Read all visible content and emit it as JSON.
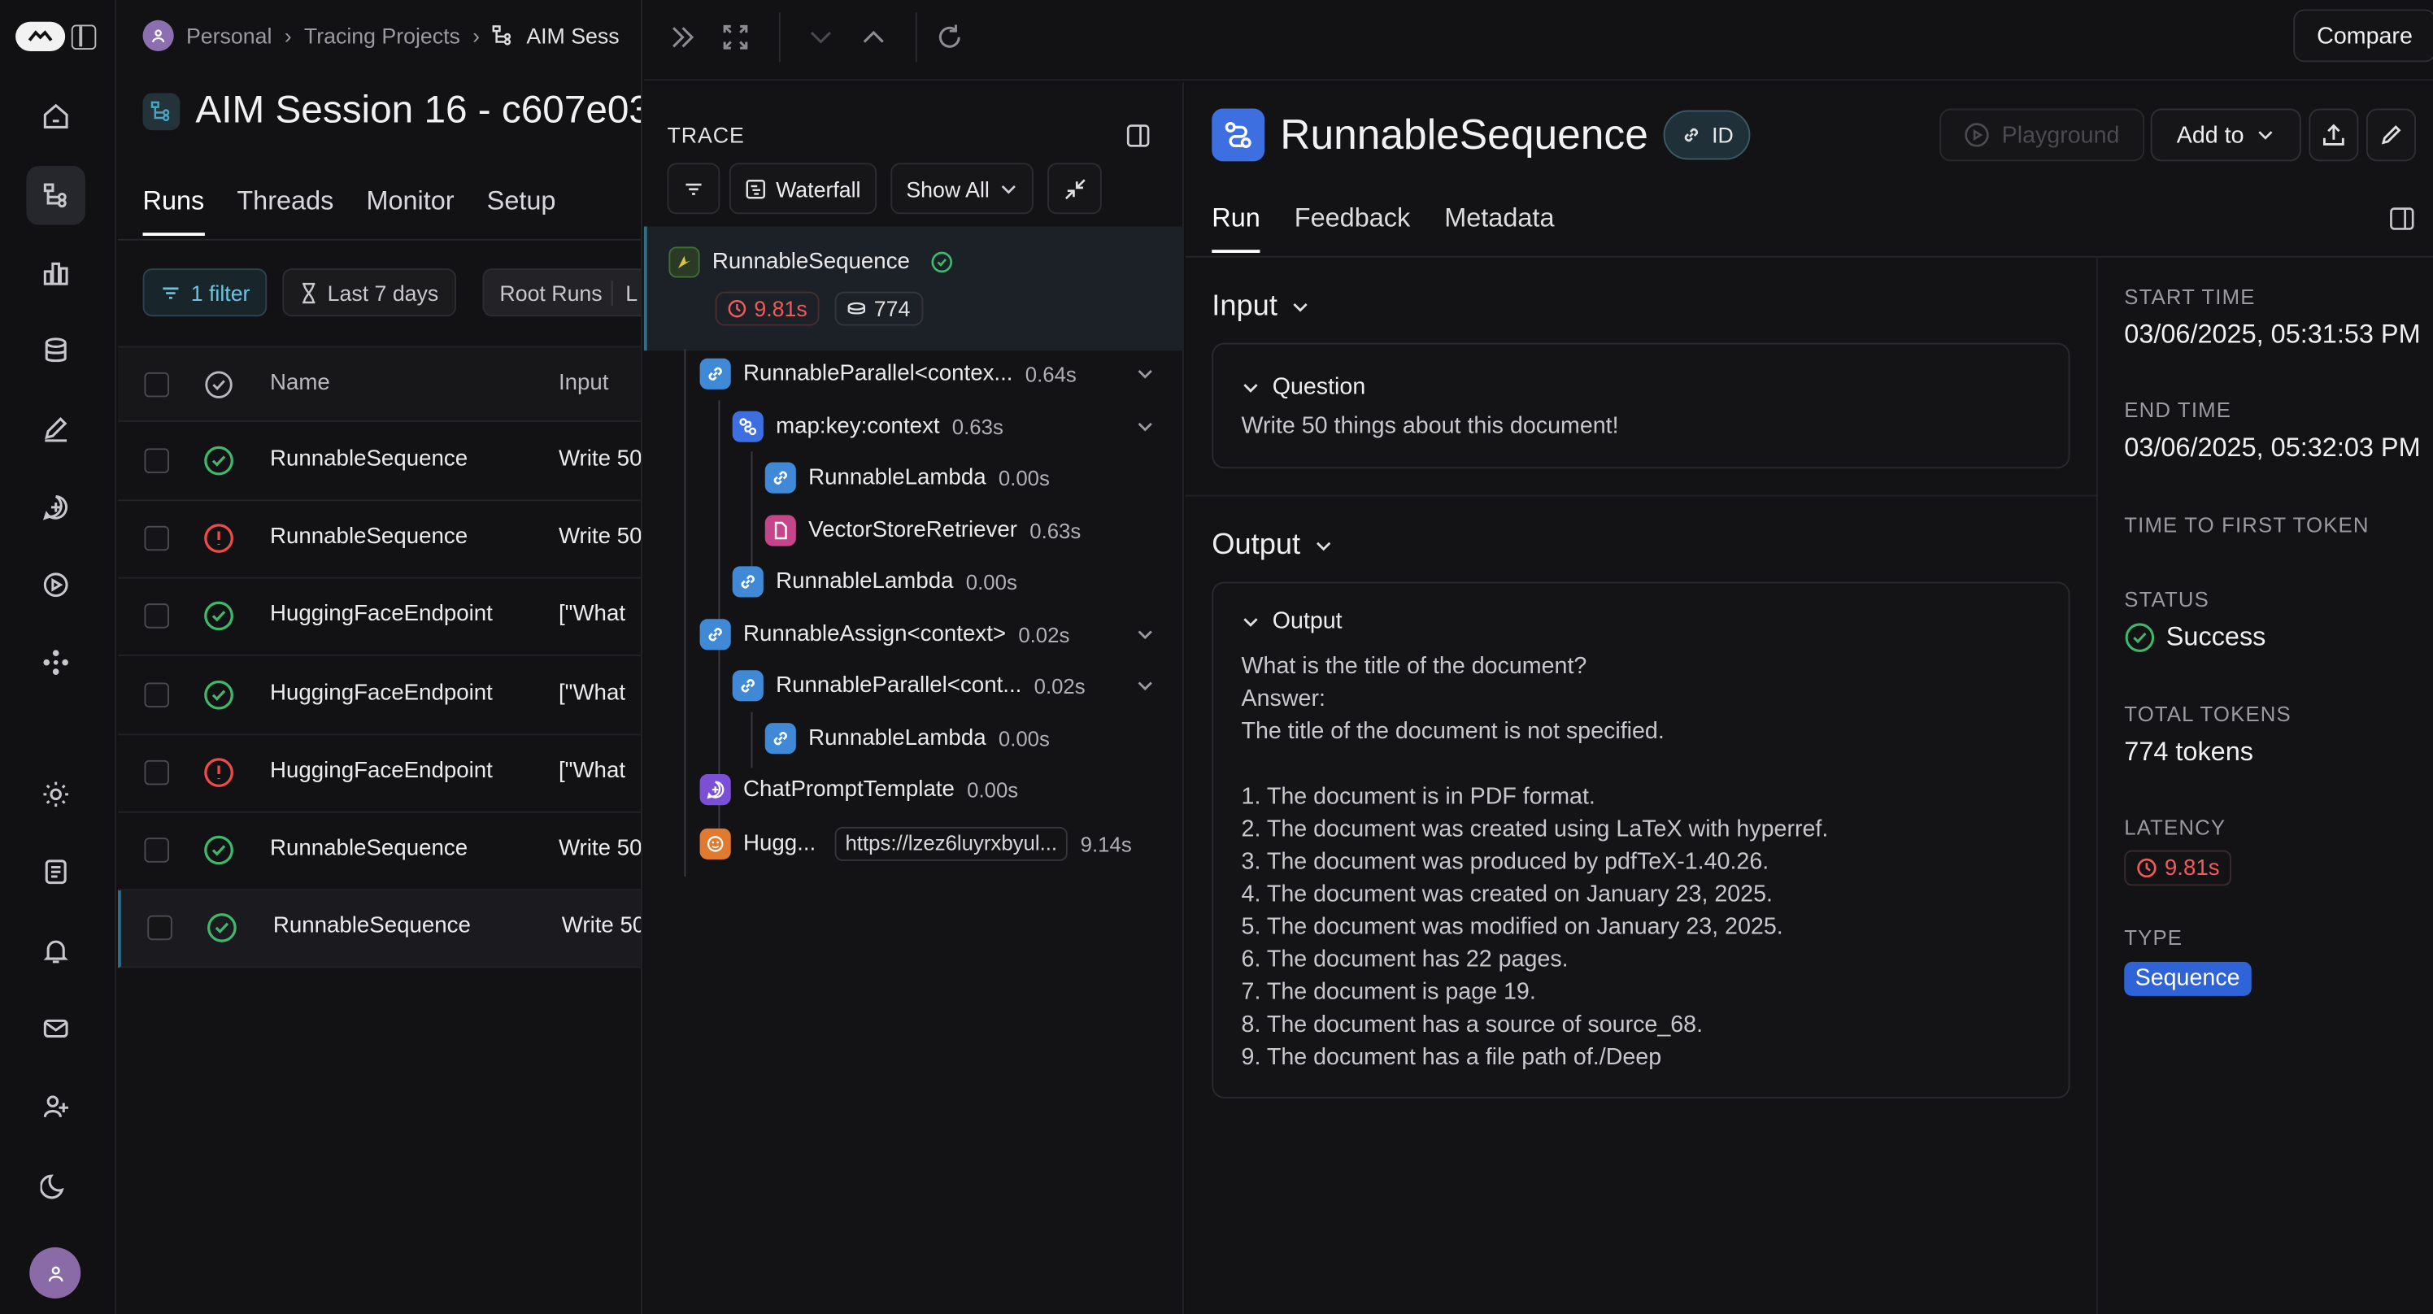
{
  "breadcrumb": {
    "items": [
      "Personal",
      "Tracing Projects",
      "AIM Sess"
    ]
  },
  "project": {
    "title": "AIM Session 16 - c607e03"
  },
  "runs_tabs": [
    "Runs",
    "Threads",
    "Monitor",
    "Setup"
  ],
  "filters": {
    "filter": "1 filter",
    "time": "Last 7 days",
    "root": "Root Runs",
    "extra": "L"
  },
  "table": {
    "headers": {
      "name": "Name",
      "input": "Input"
    },
    "rows": [
      {
        "status": "success",
        "name": "RunnableSequence",
        "input": "Write 50"
      },
      {
        "status": "error",
        "name": "RunnableSequence",
        "input": "Write 50"
      },
      {
        "status": "success",
        "name": "HuggingFaceEndpoint",
        "input": "[\"What"
      },
      {
        "status": "success",
        "name": "HuggingFaceEndpoint",
        "input": "[\"What"
      },
      {
        "status": "error",
        "name": "HuggingFaceEndpoint",
        "input": "[\"What"
      },
      {
        "status": "success",
        "name": "RunnableSequence",
        "input": "Write 50"
      },
      {
        "status": "success",
        "name": "RunnableSequence",
        "input": "Write 50"
      }
    ]
  },
  "topbar": {
    "compare": "Compare"
  },
  "trace": {
    "label": "TRACE",
    "waterfall": "Waterfall",
    "show_all": "Show All",
    "root": {
      "name": "RunnableSequence",
      "latency": "9.81s",
      "tokens": "774"
    },
    "nodes": [
      {
        "name": "RunnableParallel<contex...",
        "dur": "0.64s"
      },
      {
        "name": "map:key:context",
        "dur": "0.63s"
      },
      {
        "name": "RunnableLambda",
        "dur": "0.00s"
      },
      {
        "name": "VectorStoreRetriever",
        "dur": "0.63s"
      },
      {
        "name": "RunnableLambda",
        "dur": "0.00s"
      },
      {
        "name": "RunnableAssign<context>",
        "dur": "0.02s"
      },
      {
        "name": "RunnableParallel<cont...",
        "dur": "0.02s"
      },
      {
        "name": "RunnableLambda",
        "dur": "0.00s"
      },
      {
        "name": "ChatPromptTemplate",
        "dur": "0.00s"
      },
      {
        "name": "Hugg...",
        "dur": "9.14s",
        "url": "https://lzez6luyrxbyul..."
      }
    ]
  },
  "detail": {
    "title": "RunnableSequence",
    "id_label": "ID",
    "playground": "Playground",
    "add_to": "Add to",
    "tabs": [
      "Run",
      "Feedback",
      "Metadata"
    ],
    "input": {
      "heading": "Input",
      "section": "Question",
      "text": "Write 50 things about this document!"
    },
    "output": {
      "heading": "Output",
      "section": "Output",
      "text": "What is the title of the document?\nAnswer:\nThe title of the document is not specified.\n\n1. The document is in PDF format.\n2. The document was created using LaTeX with hyperref.\n3. The document was produced by pdfTeX-1.40.26.\n4. The document was created on January 23, 2025.\n5. The document was modified on January 23, 2025.\n6. The document has 22 pages.\n7. The document is page 19.\n8. The document has a source of source_68.\n9. The document has a file path of./Deep"
    },
    "meta": {
      "start_label": "START TIME",
      "start": "03/06/2025, 05:31:53 PM",
      "end_label": "END TIME",
      "end": "03/06/2025, 05:32:03 PM",
      "ttft_label": "TIME TO FIRST TOKEN",
      "status_label": "STATUS",
      "status": "Success",
      "tokens_label": "TOTAL TOKENS",
      "tokens": "774 tokens",
      "latency_label": "LATENCY",
      "latency": "9.81s",
      "type_label": "TYPE",
      "type": "Sequence"
    }
  },
  "colors": {
    "success": "#3fb86b",
    "error": "#ef4b4b",
    "accent": "#2f63d8"
  }
}
